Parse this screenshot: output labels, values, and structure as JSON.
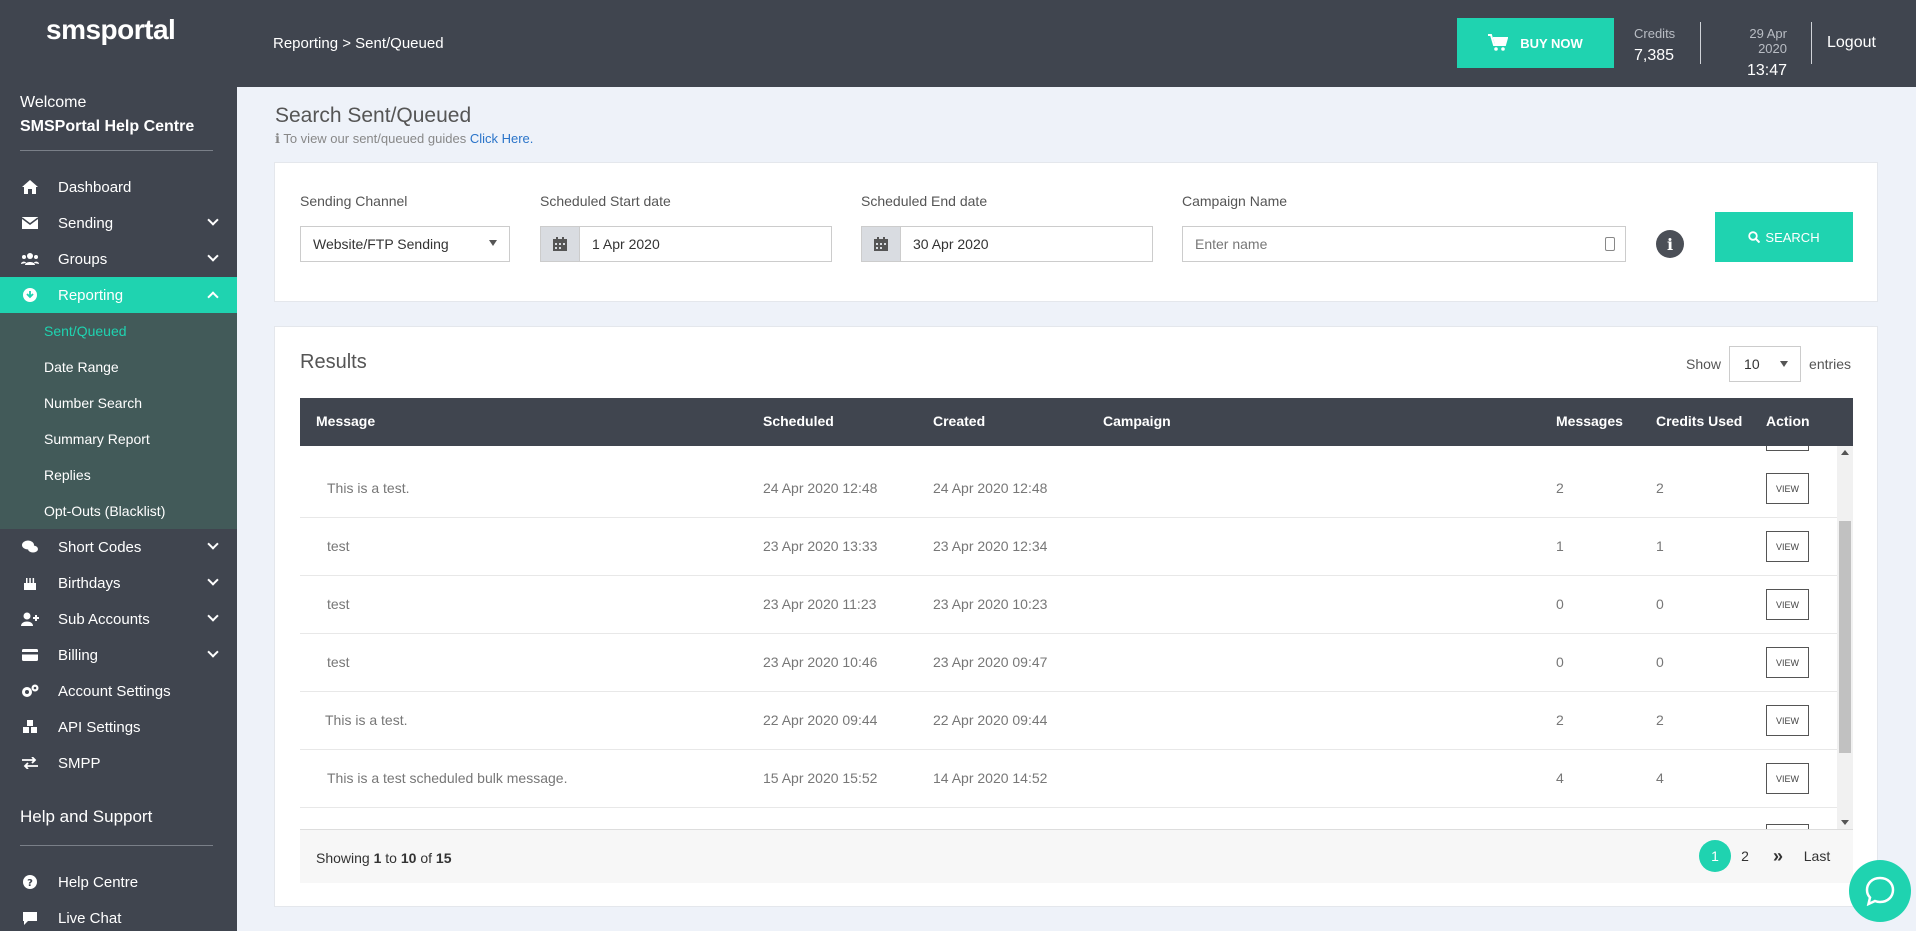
{
  "sidebar": {
    "logo_text": "smsportal",
    "welcome": "Welcome",
    "org_name": "SMSPortal Help Centre",
    "items": [
      {
        "label": "Dashboard",
        "icon": "home-icon"
      },
      {
        "label": "Sending",
        "icon": "envelope-icon"
      },
      {
        "label": "Groups",
        "icon": "users-icon"
      },
      {
        "label": "Reporting",
        "icon": "reporting-icon"
      },
      {
        "label": "Short Codes",
        "icon": "comments-icon"
      },
      {
        "label": "Birthdays",
        "icon": "cake-icon"
      },
      {
        "label": "Sub Accounts",
        "icon": "user-plus-icon"
      },
      {
        "label": "Billing",
        "icon": "credit-card-icon"
      },
      {
        "label": "Account Settings",
        "icon": "cogs-icon"
      },
      {
        "label": "API Settings",
        "icon": "cubes-icon"
      },
      {
        "label": "SMPP",
        "icon": "exchange-icon"
      }
    ],
    "reporting_sub": [
      "Sent/Queued",
      "Date Range",
      "Number Search",
      "Summary Report",
      "Replies",
      "Opt-Outs (Blacklist)"
    ],
    "help_heading": "Help and Support",
    "help_items": [
      {
        "label": "Help Centre",
        "icon": "question-icon"
      },
      {
        "label": "Live Chat",
        "icon": "chat-icon"
      }
    ]
  },
  "topbar": {
    "breadcrumb": "Reporting > Sent/Queued",
    "buy_label": "BUY NOW",
    "credits_label": "Credits",
    "credits_value": "7,385",
    "date": "29 Apr 2020",
    "time": "13:47",
    "logout": "Logout"
  },
  "page": {
    "title": "Search Sent/Queued",
    "guide_text": "To view our sent/queued guides",
    "guide_link": "Click Here."
  },
  "filters": {
    "channel_label": "Sending Channel",
    "channel_value": "Website/FTP Sending",
    "start_label": "Scheduled Start date",
    "start_value": "1 Apr 2020",
    "end_label": "Scheduled End date",
    "end_value": "30 Apr 2020",
    "campaign_label": "Campaign Name",
    "campaign_placeholder": "Enter name",
    "search_label": "SEARCH"
  },
  "results": {
    "title": "Results",
    "show_label": "Show",
    "show_value": "10",
    "entries_label": "entries",
    "columns": [
      "Message",
      "Scheduled",
      "Created",
      "Campaign",
      "Messages",
      "Credits Used",
      "Action"
    ],
    "rows": [
      {
        "message": "This is a test.",
        "scheduled": "24 Apr 2020 12:48",
        "created": "24 Apr 2020 12:48",
        "campaign": "",
        "messages": "2",
        "credits": "2",
        "action": "VIEW"
      },
      {
        "message": "test",
        "scheduled": "23 Apr 2020 13:33",
        "created": "23 Apr 2020 12:34",
        "campaign": "",
        "messages": "1",
        "credits": "1",
        "action": "VIEW"
      },
      {
        "message": "test",
        "scheduled": "23 Apr 2020 11:23",
        "created": "23 Apr 2020 10:23",
        "campaign": "",
        "messages": "0",
        "credits": "0",
        "action": "VIEW"
      },
      {
        "message": "test",
        "scheduled": "23 Apr 2020 10:46",
        "created": "23 Apr 2020 09:47",
        "campaign": "",
        "messages": "0",
        "credits": "0",
        "action": "VIEW"
      },
      {
        "message": "This is a test.",
        "scheduled": "22 Apr 2020 09:44",
        "created": "22 Apr 2020 09:44",
        "campaign": "",
        "messages": "2",
        "credits": "2",
        "action": "VIEW"
      },
      {
        "message": "This is a test scheduled bulk message.",
        "scheduled": "15 Apr 2020 15:52",
        "created": "14 Apr 2020 14:52",
        "campaign": "",
        "messages": "4",
        "credits": "4",
        "action": "VIEW"
      }
    ],
    "showing_prefix": "Showing",
    "showing_from": "1",
    "showing_to_word": "to",
    "showing_to": "10",
    "showing_of_word": "of",
    "showing_total": "15",
    "pages": [
      "1",
      "2"
    ],
    "next_label": "»",
    "last_label": "Last"
  },
  "colors": {
    "accent": "#1fd3b0",
    "dark": "#40454f",
    "submenu": "#425a59"
  }
}
